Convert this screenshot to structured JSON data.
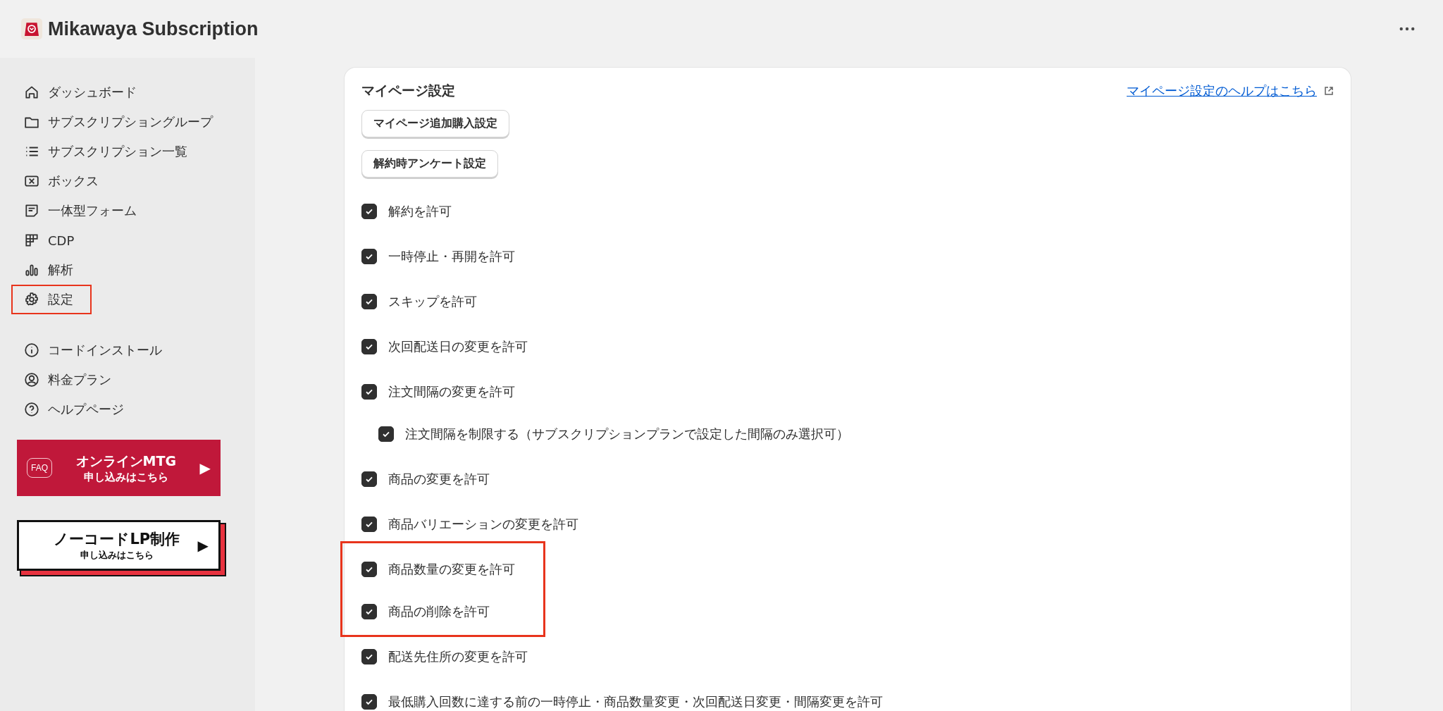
{
  "app": {
    "title": "Mikawaya Subscription"
  },
  "sidebar": {
    "groups": [
      [
        {
          "label": "ダッシュボード",
          "annotated": false
        },
        {
          "label": "サブスクリプショングループ",
          "annotated": false
        },
        {
          "label": "サブスクリプション一覧",
          "annotated": false
        },
        {
          "label": "ボックス",
          "annotated": false
        },
        {
          "label": "一体型フォーム",
          "annotated": false
        },
        {
          "label": "CDP",
          "annotated": false
        },
        {
          "label": "解析",
          "annotated": false
        },
        {
          "label": "設定",
          "annotated": true
        }
      ],
      [
        {
          "label": "コードインストール",
          "annotated": false
        },
        {
          "label": "料金プラン",
          "annotated": false
        },
        {
          "label": "ヘルプページ",
          "annotated": false
        }
      ]
    ],
    "banners": [
      {
        "kind": "red",
        "badge": "FAQ",
        "title": "オンラインMTG",
        "subtitle": "申し込みはこちら",
        "arrow": "▶"
      },
      {
        "kind": "white",
        "title": "ノーコードLP制作",
        "subtitle": "申し込みはこちら",
        "arrow": "▶"
      }
    ]
  },
  "card": {
    "title": "マイページ設定",
    "help_link": "マイページ設定のヘルプはこちら",
    "buttons": [
      "マイページ追加購入設定",
      "解約時アンケート設定"
    ],
    "options": [
      {
        "label": "解約を許可",
        "checked": true,
        "annotated": false
      },
      {
        "label": "一時停止・再開を許可",
        "checked": true,
        "annotated": false
      },
      {
        "label": "スキップを許可",
        "checked": true,
        "annotated": false
      },
      {
        "label": "次回配送日の変更を許可",
        "checked": true,
        "annotated": false
      },
      {
        "label": "注文間隔の変更を許可",
        "checked": true,
        "annotated": false,
        "children": [
          {
            "label": "注文間隔を制限する（サブスクリプションプランで設定した間隔のみ選択可）",
            "checked": true
          }
        ]
      },
      {
        "label": "商品の変更を許可",
        "checked": true,
        "annotated": false
      },
      {
        "label": "商品バリエーションの変更を許可",
        "checked": true,
        "annotated": false
      },
      {
        "label": "商品数量の変更を許可",
        "checked": true,
        "annotated": true
      },
      {
        "label": "商品の削除を許可",
        "checked": true,
        "annotated": true
      },
      {
        "label": "配送先住所の変更を許可",
        "checked": true,
        "annotated": false
      },
      {
        "label": "最低購入回数に達する前の一時停止・商品数量変更・次回配送日変更・間隔変更を許可",
        "checked": true,
        "annotated": false
      }
    ]
  }
}
